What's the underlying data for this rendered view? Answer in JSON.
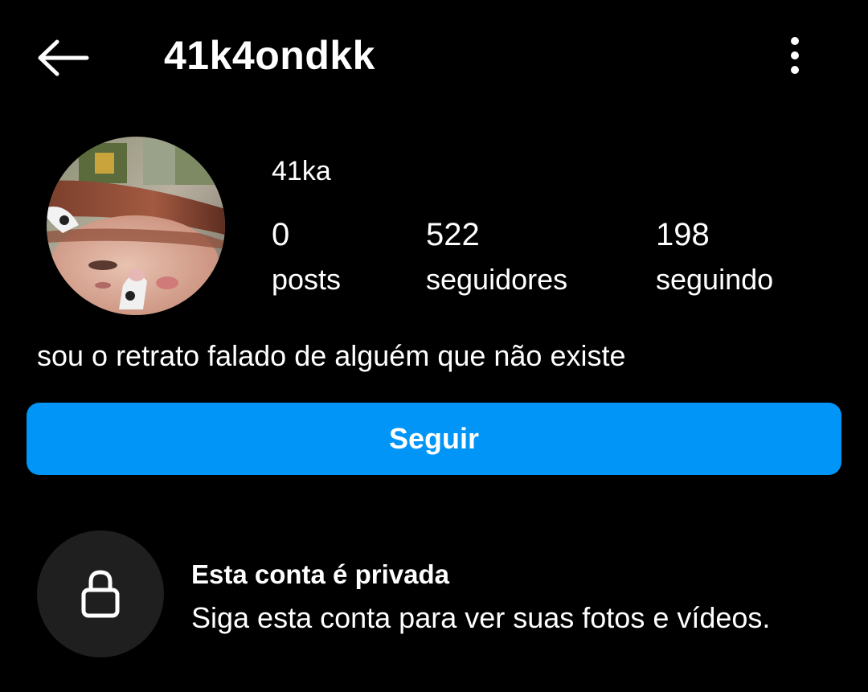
{
  "header": {
    "back_icon": "arrow-left-icon",
    "username": "41k4ondkk",
    "more_icon": "more-vertical-icon"
  },
  "profile": {
    "avatar_description": "profile-photo",
    "display_name": "41ka",
    "stats": {
      "posts": {
        "value": "0",
        "label": "posts"
      },
      "followers": {
        "value": "522",
        "label": "seguidores"
      },
      "following": {
        "value": "198",
        "label": "seguindo"
      }
    },
    "bio": "sou o retrato falado de alguém que não existe"
  },
  "actions": {
    "follow_label": "Seguir"
  },
  "private_notice": {
    "icon": "lock-icon",
    "title": "Esta conta é privada",
    "description": "Siga esta conta para ver suas fotos e vídeos."
  },
  "colors": {
    "background": "#000000",
    "text": "#ffffff",
    "follow_button": "#0095f6",
    "lock_circle": "#1f1f1f"
  }
}
